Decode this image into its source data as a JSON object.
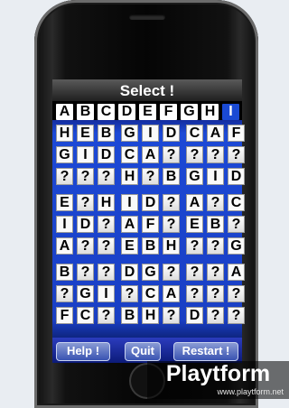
{
  "screen": {
    "title": "Select !",
    "selectable_letters": [
      "A",
      "B",
      "C",
      "D",
      "E",
      "F",
      "G",
      "H",
      "I"
    ],
    "active_letter": "I",
    "grid": [
      [
        "H",
        "E",
        "B",
        "G",
        "I",
        "D",
        "C",
        "A",
        "F"
      ],
      [
        "G",
        "I",
        "D",
        "C",
        "A",
        "?",
        "?",
        "?",
        "?"
      ],
      [
        "?",
        "?",
        "?",
        "H",
        "?",
        "B",
        "G",
        "I",
        "D"
      ],
      [
        "E",
        "?",
        "H",
        "I",
        "D",
        "?",
        "A",
        "?",
        "C"
      ],
      [
        "I",
        "D",
        "?",
        "A",
        "F",
        "?",
        "E",
        "B",
        "?"
      ],
      [
        "A",
        "?",
        "?",
        "E",
        "B",
        "H",
        "?",
        "?",
        "G"
      ],
      [
        "B",
        "?",
        "?",
        "D",
        "G",
        "?",
        "?",
        "?",
        "A"
      ],
      [
        "?",
        "G",
        "I",
        "?",
        "C",
        "A",
        "?",
        "?",
        "?"
      ],
      [
        "F",
        "C",
        "?",
        "B",
        "H",
        "?",
        "D",
        "?",
        "?"
      ]
    ],
    "buttons": {
      "help": "Help !",
      "quit": "Quit",
      "restart": "Restart !"
    }
  },
  "watermark": {
    "logo": "Playtform",
    "url": "www.playtform.net"
  }
}
